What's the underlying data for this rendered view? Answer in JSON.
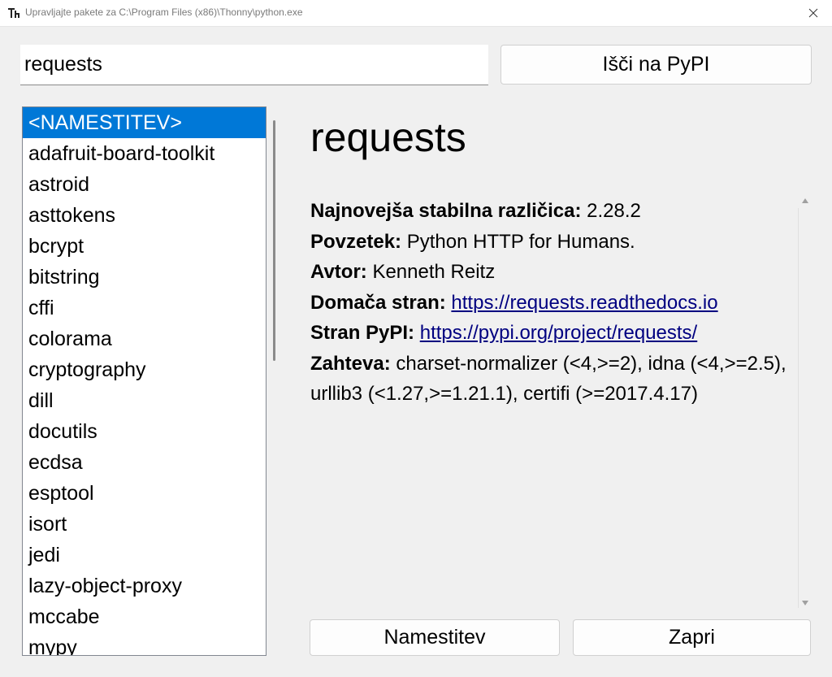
{
  "window": {
    "title": "Upravljajte pakete za C:\\Program Files (x86)\\Thonny\\python.exe"
  },
  "search": {
    "value": "requests",
    "button_label": "Išči na PyPI"
  },
  "packages": {
    "items": [
      "<NAMESTITEV>",
      "adafruit-board-toolkit",
      "astroid",
      "asttokens",
      "bcrypt",
      "bitstring",
      "cffi",
      "colorama",
      "cryptography",
      "dill",
      "docutils",
      "ecdsa",
      "esptool",
      "isort",
      "jedi",
      "lazy-object-proxy",
      "mccabe",
      "mypy"
    ],
    "selected": "<NAMESTITEV>"
  },
  "details": {
    "name": "requests",
    "latest_label": "Najnovejša stabilna različica:",
    "latest_value": "2.28.2",
    "summary_label": "Povzetek:",
    "summary_value": "Python HTTP for Humans.",
    "author_label": "Avtor:",
    "author_value": "Kenneth Reitz",
    "homepage_label": "Domača stran:",
    "homepage_value": "https://requests.readthedocs.io",
    "pypi_label": "Stran PyPI:",
    "pypi_value": "https://pypi.org/project/requests/",
    "requires_label": "Zahteva:",
    "requires_value": "charset-normalizer (<4,>=2), idna (<4,>=2.5), urllib3 (<1.27,>=1.21.1), certifi (>=2017.4.17)"
  },
  "actions": {
    "install_label": "Namestitev",
    "close_label": "Zapri"
  },
  "colors": {
    "selection": "#0078d7",
    "link": "#000080"
  }
}
